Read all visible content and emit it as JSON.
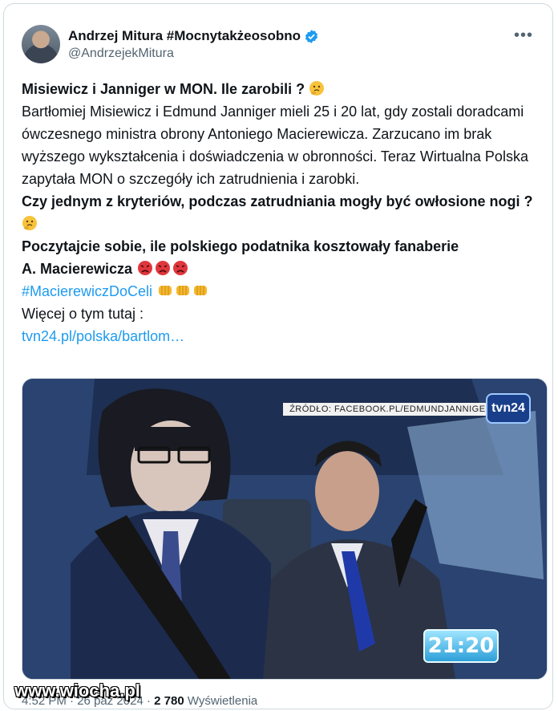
{
  "author": {
    "name": "Andrzej Mitura #Mocnytakżeosobno",
    "handle": "@AndrzejekMitura"
  },
  "tweet": {
    "title": "Misiewicz i Janniger w MON. Ile zarobili ?",
    "body": "Bartłomiej Misiewicz i Edmund Janniger mieli 25 i 20 lat, gdy zostali doradcami ówczesnego ministra obrony Antoniego Macierewicza. Zarzucano im brak wyższego wykształcenia i doświadczenia w obronności. Teraz Wirtualna Polska zapytała MON o szczegóły ich zatrudnienia i zarobki.",
    "question": "Czy jednym z kryteriów, podczas zatrudniania mogły być owłosione nogi ?",
    "comment": "Poczytajcie sobie, ile polskiego podatnika kosztowały fanaberie",
    "comment_name": " A. Macierewicza",
    "hashtag": "#MacierewiczDoCeli",
    "more_label": "Więcej o tym tutaj :",
    "link": "tvn24.pl/polska/bartlom…"
  },
  "media": {
    "source_caption": "ŹRÓDŁO: FACEBOOK.PL/EDMUNDJANNIGER",
    "channel_logo": "tvn24",
    "program_time": "21:20"
  },
  "meta": {
    "time": "4:52 PM",
    "separator": "·",
    "date": "26 paź 2024",
    "views": "2 780",
    "views_label": "Wyświetlenia"
  },
  "watermark": "www.wiocha.pl",
  "icons": {
    "verified": "verified-badge-icon",
    "more": "more-options-icon",
    "thinking": "thinking-face-emoji",
    "angry": "angry-face-emoji",
    "fist": "oncoming-fist-emoji"
  },
  "colors": {
    "link": "#1d9bf0",
    "verified": "#1d9bf0",
    "secondary_text": "#536471"
  }
}
